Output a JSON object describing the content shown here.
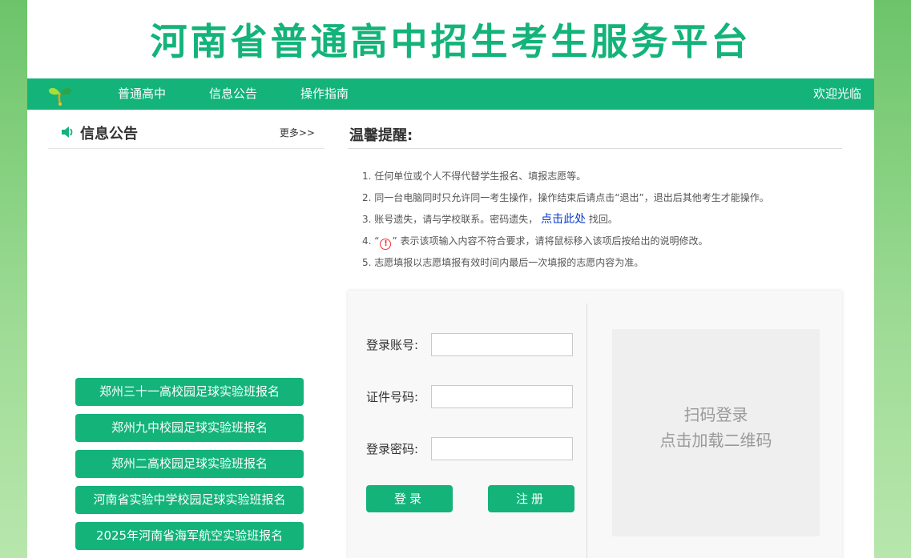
{
  "header": {
    "title": "河南省普通高中招生考生服务平台"
  },
  "nav": {
    "items": [
      {
        "label": "普通高中"
      },
      {
        "label": "信息公告"
      },
      {
        "label": "操作指南"
      }
    ],
    "welcome": "欢迎光临"
  },
  "notice": {
    "title": "信息公告",
    "more": "更多>>",
    "buttons": [
      {
        "label": "郑州三十一高校园足球实验班报名"
      },
      {
        "label": "郑州九中校园足球实验班报名"
      },
      {
        "label": "郑州二高校园足球实验班报名"
      },
      {
        "label": "河南省实验中学校园足球实验班报名"
      },
      {
        "label": "2025年河南省海军航空实验班报名"
      }
    ]
  },
  "tips": {
    "title": "温馨提醒:",
    "items": [
      {
        "text": "1. 任何单位或个人不得代替学生报名、填报志愿等。"
      },
      {
        "text": "2. 同一台电脑同时只允许同一考生操作，操作结束后请点击“退出”，退出后其他考生才能操作。"
      },
      {
        "prefix": "3. 账号遗失，请与学校联系。密码遗失，",
        "link": "点击此处",
        "suffix": "找回。"
      },
      {
        "prefix": "4. “",
        "icon": "!",
        "suffix": "” 表示该项输入内容不符合要求，请将鼠标移入该项后按给出的说明修改。"
      },
      {
        "text": "5. 志愿填报以志愿填报有效时间内最后一次填报的志愿内容为准。"
      }
    ]
  },
  "login": {
    "account_label": "登录账号:",
    "id_label": "证件号码:",
    "password_label": "登录密码:",
    "account_value": "",
    "id_value": "",
    "password_value": "",
    "login_button": "登录",
    "register_button": "注册"
  },
  "qr": {
    "line1": "扫码登录",
    "line2": "点击加载二维码"
  },
  "colors": {
    "brand": "#13b37a",
    "link": "#0a3bcc",
    "warning": "#ee3333"
  }
}
